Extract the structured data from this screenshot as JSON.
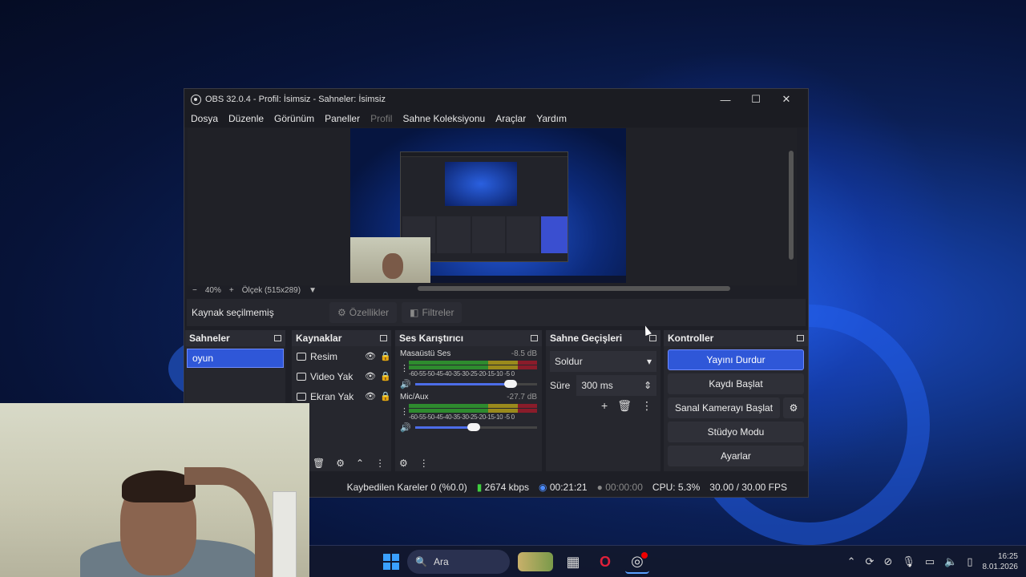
{
  "window": {
    "title": "OBS 32.0.4 - Profil: İsimsiz - Sahneler: İsimsiz",
    "minimize": "—",
    "maximize": "☐",
    "close": "✕"
  },
  "menu": [
    "Dosya",
    "Düzenle",
    "Görünüm",
    "Paneller",
    "Profil",
    "Sahne Koleksiyonu",
    "Araçlar",
    "Yardım"
  ],
  "preview": {
    "zoom_minus": "−",
    "zoom_value": "40%",
    "zoom_plus": "+",
    "scale": "Ölçek (515x289)"
  },
  "source_bar": {
    "label": "Kaynak seçilmemiş",
    "properties": "Özellikler",
    "filters": "Filtreler"
  },
  "scenes": {
    "title": "Sahneler",
    "items": [
      "oyun"
    ]
  },
  "sources": {
    "title": "Kaynaklar",
    "items": [
      "Resim",
      "Video Yak",
      "Ekran Yak"
    ]
  },
  "mixer": {
    "title": "Ses Karıştırıcı",
    "channels": [
      {
        "name": "Masaüstü Ses",
        "db": "-8.5 dB",
        "volume": 0.78
      },
      {
        "name": "Mic/Aux",
        "db": "-27.7 dB",
        "volume": 0.48
      }
    ],
    "ticks": "-60-55-50-45-40-35-30-25-20-15-10 -5  0"
  },
  "transitions": {
    "title": "Sahne Geçişleri",
    "selected": "Soldur",
    "duration_label": "Süre",
    "duration_value": "300 ms"
  },
  "controls": {
    "title": "Kontroller",
    "stop_stream": "Yayını Durdur",
    "start_record": "Kaydı Başlat",
    "virtual_cam": "Sanal Kamerayı Başlat",
    "studio_mode": "Stüdyo Modu",
    "settings": "Ayarlar"
  },
  "status": {
    "dropped": "Kaybedilen Kareler 0 (%0.0)",
    "bitrate": "2674 kbps",
    "stream_time": "00:21:21",
    "record_time": "00:00:00",
    "cpu": "CPU: 5.3%",
    "fps": "30.00 / 30.00 FPS"
  },
  "taskbar": {
    "search": "Ara",
    "time": "16:25",
    "date": "8.01.2026"
  },
  "colors": {
    "accent": "#2f57d8",
    "panel": "#26272e",
    "window": "#1e1f26"
  }
}
